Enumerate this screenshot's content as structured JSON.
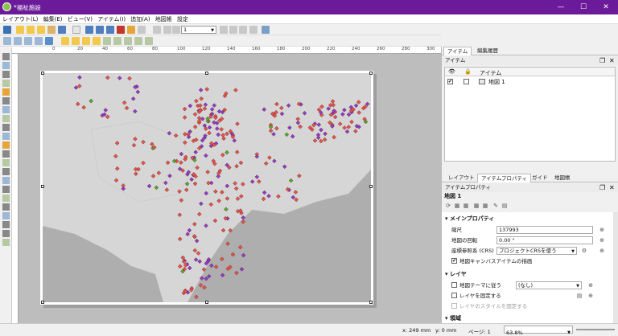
{
  "window": {
    "title": "*福祉施設",
    "minimize_glyph": "—",
    "maximize_glyph": "☐",
    "close_glyph": "✕"
  },
  "menu": [
    "レイアウト(L)",
    "編集(E)",
    "ビュー(V)",
    "アイテム(I)",
    "追加(A)",
    "地図帳",
    "設定"
  ],
  "toolbar": {
    "page_value": "1"
  },
  "ruler": {
    "ticks": [
      "0",
      "20",
      "40",
      "60",
      "80",
      "100",
      "120",
      "140",
      "160",
      "180",
      "200",
      "220",
      "240",
      "260",
      "280",
      "300"
    ]
  },
  "items_panel": {
    "tabs": [
      "アイテム",
      "編集履歴"
    ],
    "title": "アイテム",
    "column_header": "アイテム",
    "rows": [
      {
        "visible": true,
        "locked": false,
        "name": "地図 1"
      }
    ]
  },
  "props_panel": {
    "tabs": [
      "レイアウト",
      "アイテムプロパティ",
      "ガイド",
      "地図帳"
    ],
    "title": "アイテムプロパティ",
    "item_name": "地図 1",
    "main_section": "メインプロパティ",
    "scale_label": "縮尺",
    "scale_value": "137993",
    "rotation_label": "地図の回転",
    "rotation_value": "0.00 °",
    "crs_label": "座標参照系 (CRS)",
    "crs_value": "プロジェクトCRSを使う",
    "draw_canvas_items_label": "地図キャンバスアイテムの描画",
    "draw_canvas_items_checked": true,
    "layers_section": "レイヤ",
    "follow_theme_label": "地図テーマに従う",
    "follow_theme_value": "(なし)",
    "lock_layers_label": "レイヤを固定する",
    "lock_styles_label": "レイヤのスタイルを固定する",
    "extent_section": "領域"
  },
  "status": {
    "x": "x: 249 mm",
    "y": "y: 0 mm",
    "page": "ページ: 1",
    "zoom": "63.8%"
  },
  "colors": {
    "title_bar": "#6b1a9a",
    "marker_red": "#e8534a",
    "marker_purple": "#8e3bd1",
    "marker_green": "#4caf2a"
  }
}
